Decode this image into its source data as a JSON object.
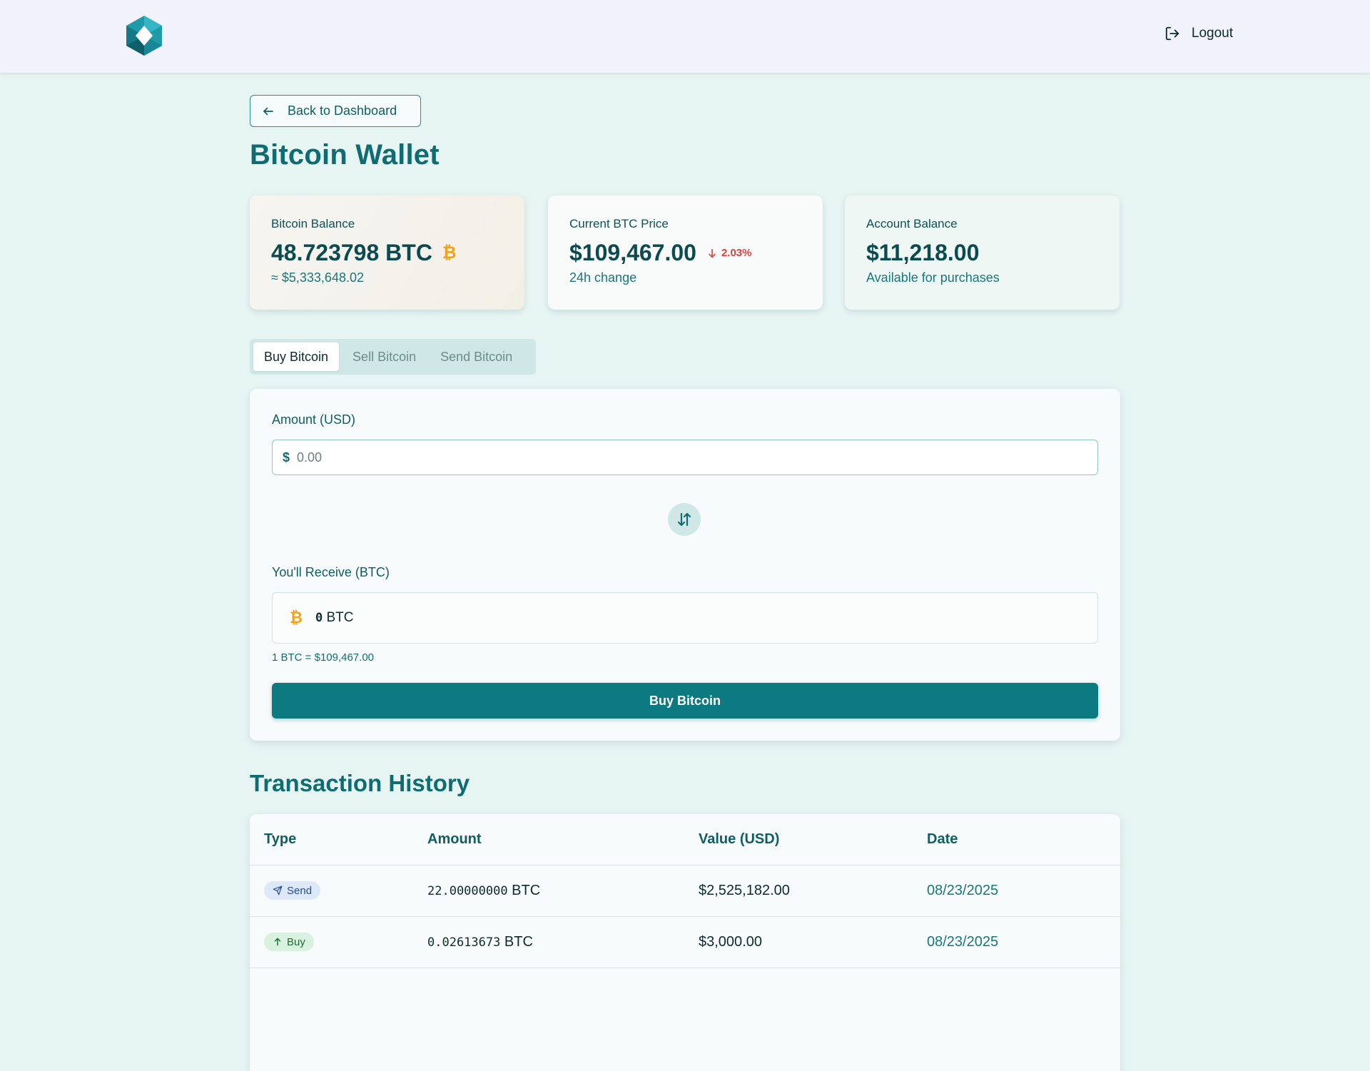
{
  "header": {
    "logout_label": "Logout"
  },
  "nav": {
    "back_label": "Back to Dashboard"
  },
  "page": {
    "title": "Bitcoin Wallet"
  },
  "cards": {
    "btc_balance": {
      "label": "Bitcoin Balance",
      "value": "48.723798 BTC",
      "icon": "₿",
      "sub": "≈ $5,333,648.02"
    },
    "btc_price": {
      "label": "Current BTC Price",
      "value": "$109,467.00",
      "change": "2.03%",
      "sub": "24h change"
    },
    "account_balance": {
      "label": "Account Balance",
      "value": "$11,218.00",
      "sub": "Available for purchases"
    }
  },
  "tabs": [
    {
      "label": "Buy Bitcoin",
      "active": true
    },
    {
      "label": "Sell Bitcoin",
      "active": false
    },
    {
      "label": "Send Bitcoin",
      "active": false
    }
  ],
  "buy_form": {
    "amount_label": "Amount (USD)",
    "currency_symbol": "$",
    "amount_placeholder": "0.00",
    "receive_label": "You'll Receive (BTC)",
    "receive_icon": "₿",
    "receive_amount": "0",
    "receive_unit": "BTC",
    "rate_text": "1 BTC = $109,467.00",
    "submit_label": "Buy Bitcoin"
  },
  "history": {
    "title": "Transaction History",
    "columns": [
      "Type",
      "Amount",
      "Value (USD)",
      "Date"
    ],
    "rows": [
      {
        "type": "Send",
        "amount": "22.00000000",
        "unit": "BTC",
        "value": "$2,525,182.00",
        "date": "08/23/2025"
      },
      {
        "type": "Buy",
        "amount": "0.02613673",
        "unit": "BTC",
        "value": "$3,000.00",
        "date": "08/23/2025"
      }
    ]
  },
  "colors": {
    "brand": "#0f6c72",
    "primary_button": "#0d7a82",
    "negative": "#d9413f",
    "bitcoin": "#f2a21a"
  }
}
